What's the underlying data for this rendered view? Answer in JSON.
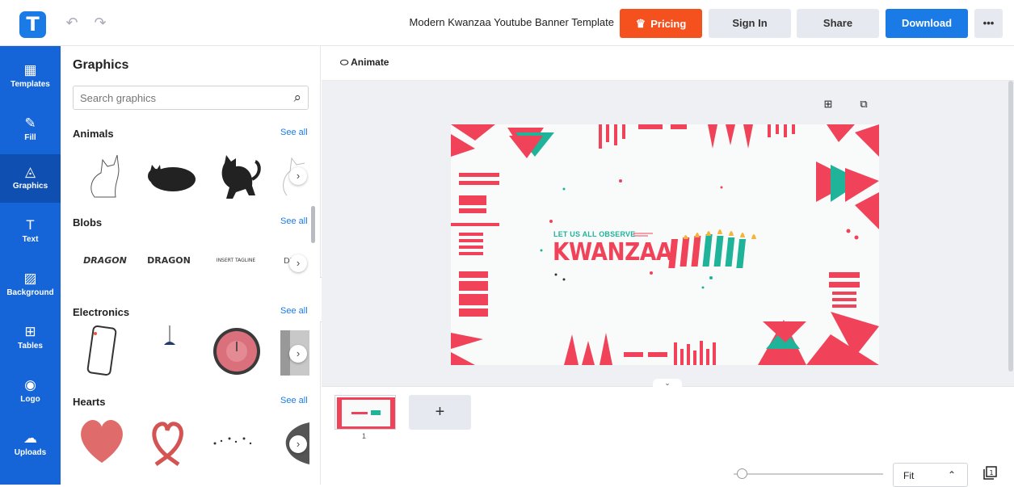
{
  "app": {
    "logo_letter": "T",
    "doc_title": "Modern Kwanzaa Youtube Banner Template"
  },
  "header": {
    "undo_icon": "↶",
    "redo_icon": "↷",
    "pricing_label": "Pricing",
    "signin_label": "Sign In",
    "share_label": "Share",
    "download_label": "Download",
    "more_label": "•••"
  },
  "sidebar": {
    "items": [
      {
        "label": "Templates",
        "icon": "▦"
      },
      {
        "label": "Fill",
        "icon": "✎"
      },
      {
        "label": "Graphics",
        "icon": "◬"
      },
      {
        "label": "Text",
        "icon": "T"
      },
      {
        "label": "Background",
        "icon": "▨"
      },
      {
        "label": "Tables",
        "icon": "⊞"
      },
      {
        "label": "Logo",
        "icon": "◉"
      },
      {
        "label": "Uploads",
        "icon": "☁"
      }
    ]
  },
  "panel": {
    "title": "Graphics",
    "search_placeholder": "Search graphics",
    "see_all": "See all",
    "categories": [
      "Animals",
      "Blobs",
      "Electronics",
      "Hearts"
    ],
    "blob_text_1": "DRAGON",
    "blob_text_2": "DRAGON",
    "blob_text_3": "INSERT TAGLINE"
  },
  "toolbar": {
    "animate_label": "Animate"
  },
  "design": {
    "observe_text": "LET US ALL OBSERVE",
    "title_text": "KWANZAA"
  },
  "bottom": {
    "page_number": "1",
    "add_page": "+",
    "fit_value": "Fit",
    "chevron": "⌃",
    "pages_icon_text": "1"
  },
  "colors": {
    "brand_blue": "#1a7be6",
    "nav_blue": "#1565d8",
    "pricing_orange": "#f4511e",
    "kwanzaa_red": "#f0435a",
    "kwanzaa_green": "#1fb39a"
  }
}
